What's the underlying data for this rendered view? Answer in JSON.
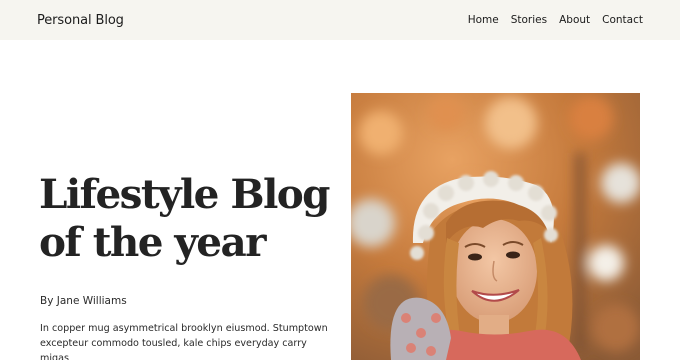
{
  "header": {
    "site_title": "Personal Blog",
    "nav": [
      {
        "label": "Home"
      },
      {
        "label": "Stories"
      },
      {
        "label": "About"
      },
      {
        "label": "Contact"
      }
    ]
  },
  "hero": {
    "title_line1": "Lifestyle Blog",
    "title_line2": "of the year",
    "byline": "By Jane Williams",
    "excerpt": "In copper mug asymmetrical brooklyn eiusmod. Stumptown excepteur commodo tousled, kale chips everyday carry migas",
    "image_subject": "portrait of smiling woman in white knit hat, autumn foliage background"
  },
  "colors": {
    "header_bg": "#f6f5f0",
    "text": "#1e1e1e",
    "foliage": "#c98a4c"
  }
}
